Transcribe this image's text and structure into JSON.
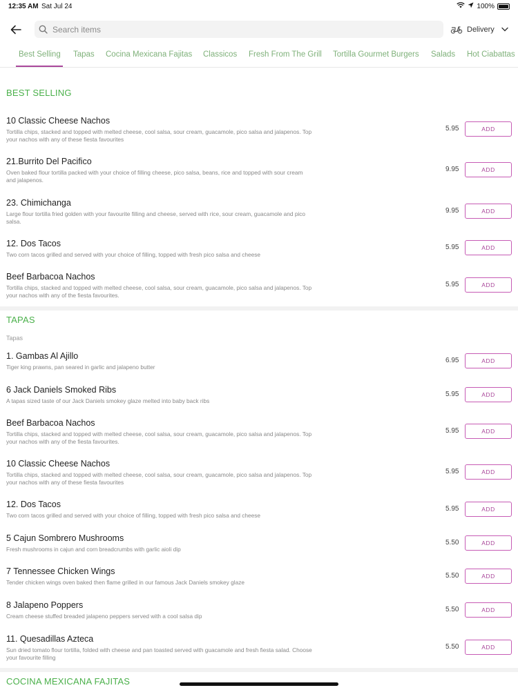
{
  "status": {
    "time": "12:35 AM",
    "date": "Sat Jul 24",
    "battery": "100%"
  },
  "search": {
    "placeholder": "Search items"
  },
  "delivery": {
    "label": "Delivery"
  },
  "tabs": [
    "Best Selling",
    "Tapas",
    "Cocina Mexicana Fajitas",
    "Classicos",
    "Fresh From The Grill",
    "Tortilla Gourmet Burgers",
    "Salads",
    "Hot Ciabattas"
  ],
  "add_label": "ADD",
  "sections": [
    {
      "title": "BEST SELLING",
      "items": [
        {
          "name": "10 Classic Cheese Nachos",
          "desc": "Tortilla chips, stacked and topped with melted cheese, cool salsa, sour cream, guacamole, pico salsa and jalapenos. Top your nachos with any of these fiesta favourites",
          "price": "5.95"
        },
        {
          "name": "21.Burrito Del Pacifico",
          "desc": "Oven baked flour tortilla packed with your choice of filling cheese, pico salsa, beans, rice and topped with sour cream and jalapenos.",
          "price": "9.95"
        },
        {
          "name": "23. Chimichanga",
          "desc": "Large flour tortilla fried golden with your favourite filling and cheese, served with rice, sour cream, guacamole and pico salsa.",
          "price": "9.95"
        },
        {
          "name": "12. Dos Tacos",
          "desc": "Two corn tacos grilled and served with your choice of filling, topped with fresh pico salsa and cheese",
          "price": "5.95"
        },
        {
          "name": "Beef Barbacoa Nachos",
          "desc": "Tortilla chips, stacked and topped with melted cheese, cool salsa, sour cream, guacamole, pico salsa and jalapenos. Top your nachos with any of the fiesta favourites.",
          "price": "5.95"
        }
      ]
    },
    {
      "title": "TAPAS",
      "sublabel": "Tapas",
      "items": [
        {
          "name": "1. Gambas Al Ajillo",
          "desc": "Tiger king prawns, pan seared in garlic and jalapeno butter",
          "price": "6.95"
        },
        {
          "name": "6 Jack Daniels Smoked Ribs",
          "desc": "A tapas sized taste of our Jack Daniels smokey glaze melted into baby back ribs",
          "price": "5.95"
        },
        {
          "name": "Beef Barbacoa Nachos",
          "desc": "Tortilla chips, stacked and topped with melted cheese, cool salsa, sour cream, guacamole, pico salsa and jalapenos. Top your nachos with any of the fiesta favourites.",
          "price": "5.95"
        },
        {
          "name": "10 Classic Cheese Nachos",
          "desc": "Tortilla chips, stacked and topped with melted cheese, cool salsa, sour cream, guacamole, pico salsa and jalapenos. Top your nachos with any of these fiesta favourites",
          "price": "5.95"
        },
        {
          "name": "12. Dos Tacos",
          "desc": "Two corn tacos grilled and served with your choice of filling, topped with fresh pico salsa and cheese",
          "price": "5.95"
        },
        {
          "name": "5 Cajun Sombrero Mushrooms",
          "desc": "Fresh mushrooms in cajun and corn breadcrumbs with garlic aioli dip",
          "price": "5.50"
        },
        {
          "name": "7 Tennessee Chicken Wings",
          "desc": "Tender chicken wings oven baked then flame grilled in our famous Jack Daniels smokey glaze",
          "price": "5.50"
        },
        {
          "name": "8 Jalapeno Poppers",
          "desc": "Cream cheese stuffed breaded jalapeno peppers served with a cool salsa dip",
          "price": "5.50"
        },
        {
          "name": "11. Quesadillas Azteca",
          "desc": "Sun dried tomato flour tortilla, folded with cheese and pan toasted served with guacamole and fresh fiesta salad. Choose your favourite filling",
          "price": "5.50"
        }
      ]
    },
    {
      "title": "COCINA MEXICANA FAJITAS"
    }
  ],
  "colors": {
    "accent": "#a9469a",
    "section": "#4ab04a",
    "tab": "#7fb17a"
  }
}
